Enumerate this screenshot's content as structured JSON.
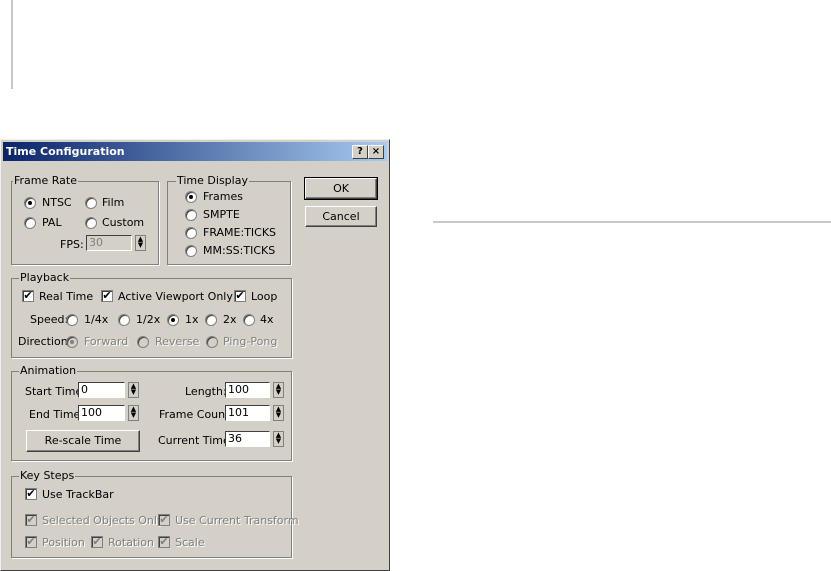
{
  "dialog": {
    "title": "Time Configuration",
    "help_label": "?",
    "close_label": "×"
  },
  "frame_rate": {
    "label": "Frame Rate",
    "options": [
      "NTSC",
      "Film",
      "PAL",
      "Custom"
    ],
    "selected": "NTSC",
    "fps_label": "FPS:",
    "fps_value": "30"
  },
  "time_display": {
    "label": "Time Display",
    "options": [
      "Frames",
      "SMPTE",
      "FRAME:TICKS",
      "MM:SS:TICKS"
    ],
    "selected": "Frames"
  },
  "buttons": {
    "ok": "OK",
    "cancel": "Cancel",
    "rescale": "Re-scale Time"
  },
  "playback": {
    "label": "Playback",
    "real_time": "Real Time",
    "active_viewport_only": "Active Viewport Only",
    "loop": "Loop",
    "checked": {
      "real_time": true,
      "active_viewport_only": true,
      "loop": true
    },
    "speed_label": "Speed:",
    "speed_options": [
      "1/4x",
      "1/2x",
      "1x",
      "2x",
      "4x"
    ],
    "speed_selected": "1x",
    "direction_label": "Direction:",
    "direction_options": [
      "Forward",
      "Reverse",
      "Ping-Pong"
    ],
    "direction_selected": "Forward"
  },
  "animation": {
    "label": "Animation",
    "start_time_label": "Start Time:",
    "start_time": "0",
    "end_time_label": "End Time:",
    "end_time": "100",
    "length_label": "Length:",
    "length": "100",
    "frame_count_label": "Frame Count:",
    "frame_count": "101",
    "current_time_label": "Current Time:",
    "current_time": "36"
  },
  "key_steps": {
    "label": "Key Steps",
    "use_trackbar": "Use TrackBar",
    "selected_objects_only": "Selected Objects Only",
    "use_current_transform": "Use Current Transform",
    "position": "Position",
    "rotation": "Rotation",
    "scale": "Scale",
    "checked": {
      "use_trackbar": true,
      "selected_objects_only": true,
      "use_current_transform": true,
      "position": true,
      "rotation": true,
      "scale": true
    }
  },
  "check_glyph": "✔",
  "colors": {
    "title_gradient_start": "#0a246a",
    "title_gradient_end": "#a6caf0",
    "face": "#d4d0c8"
  }
}
